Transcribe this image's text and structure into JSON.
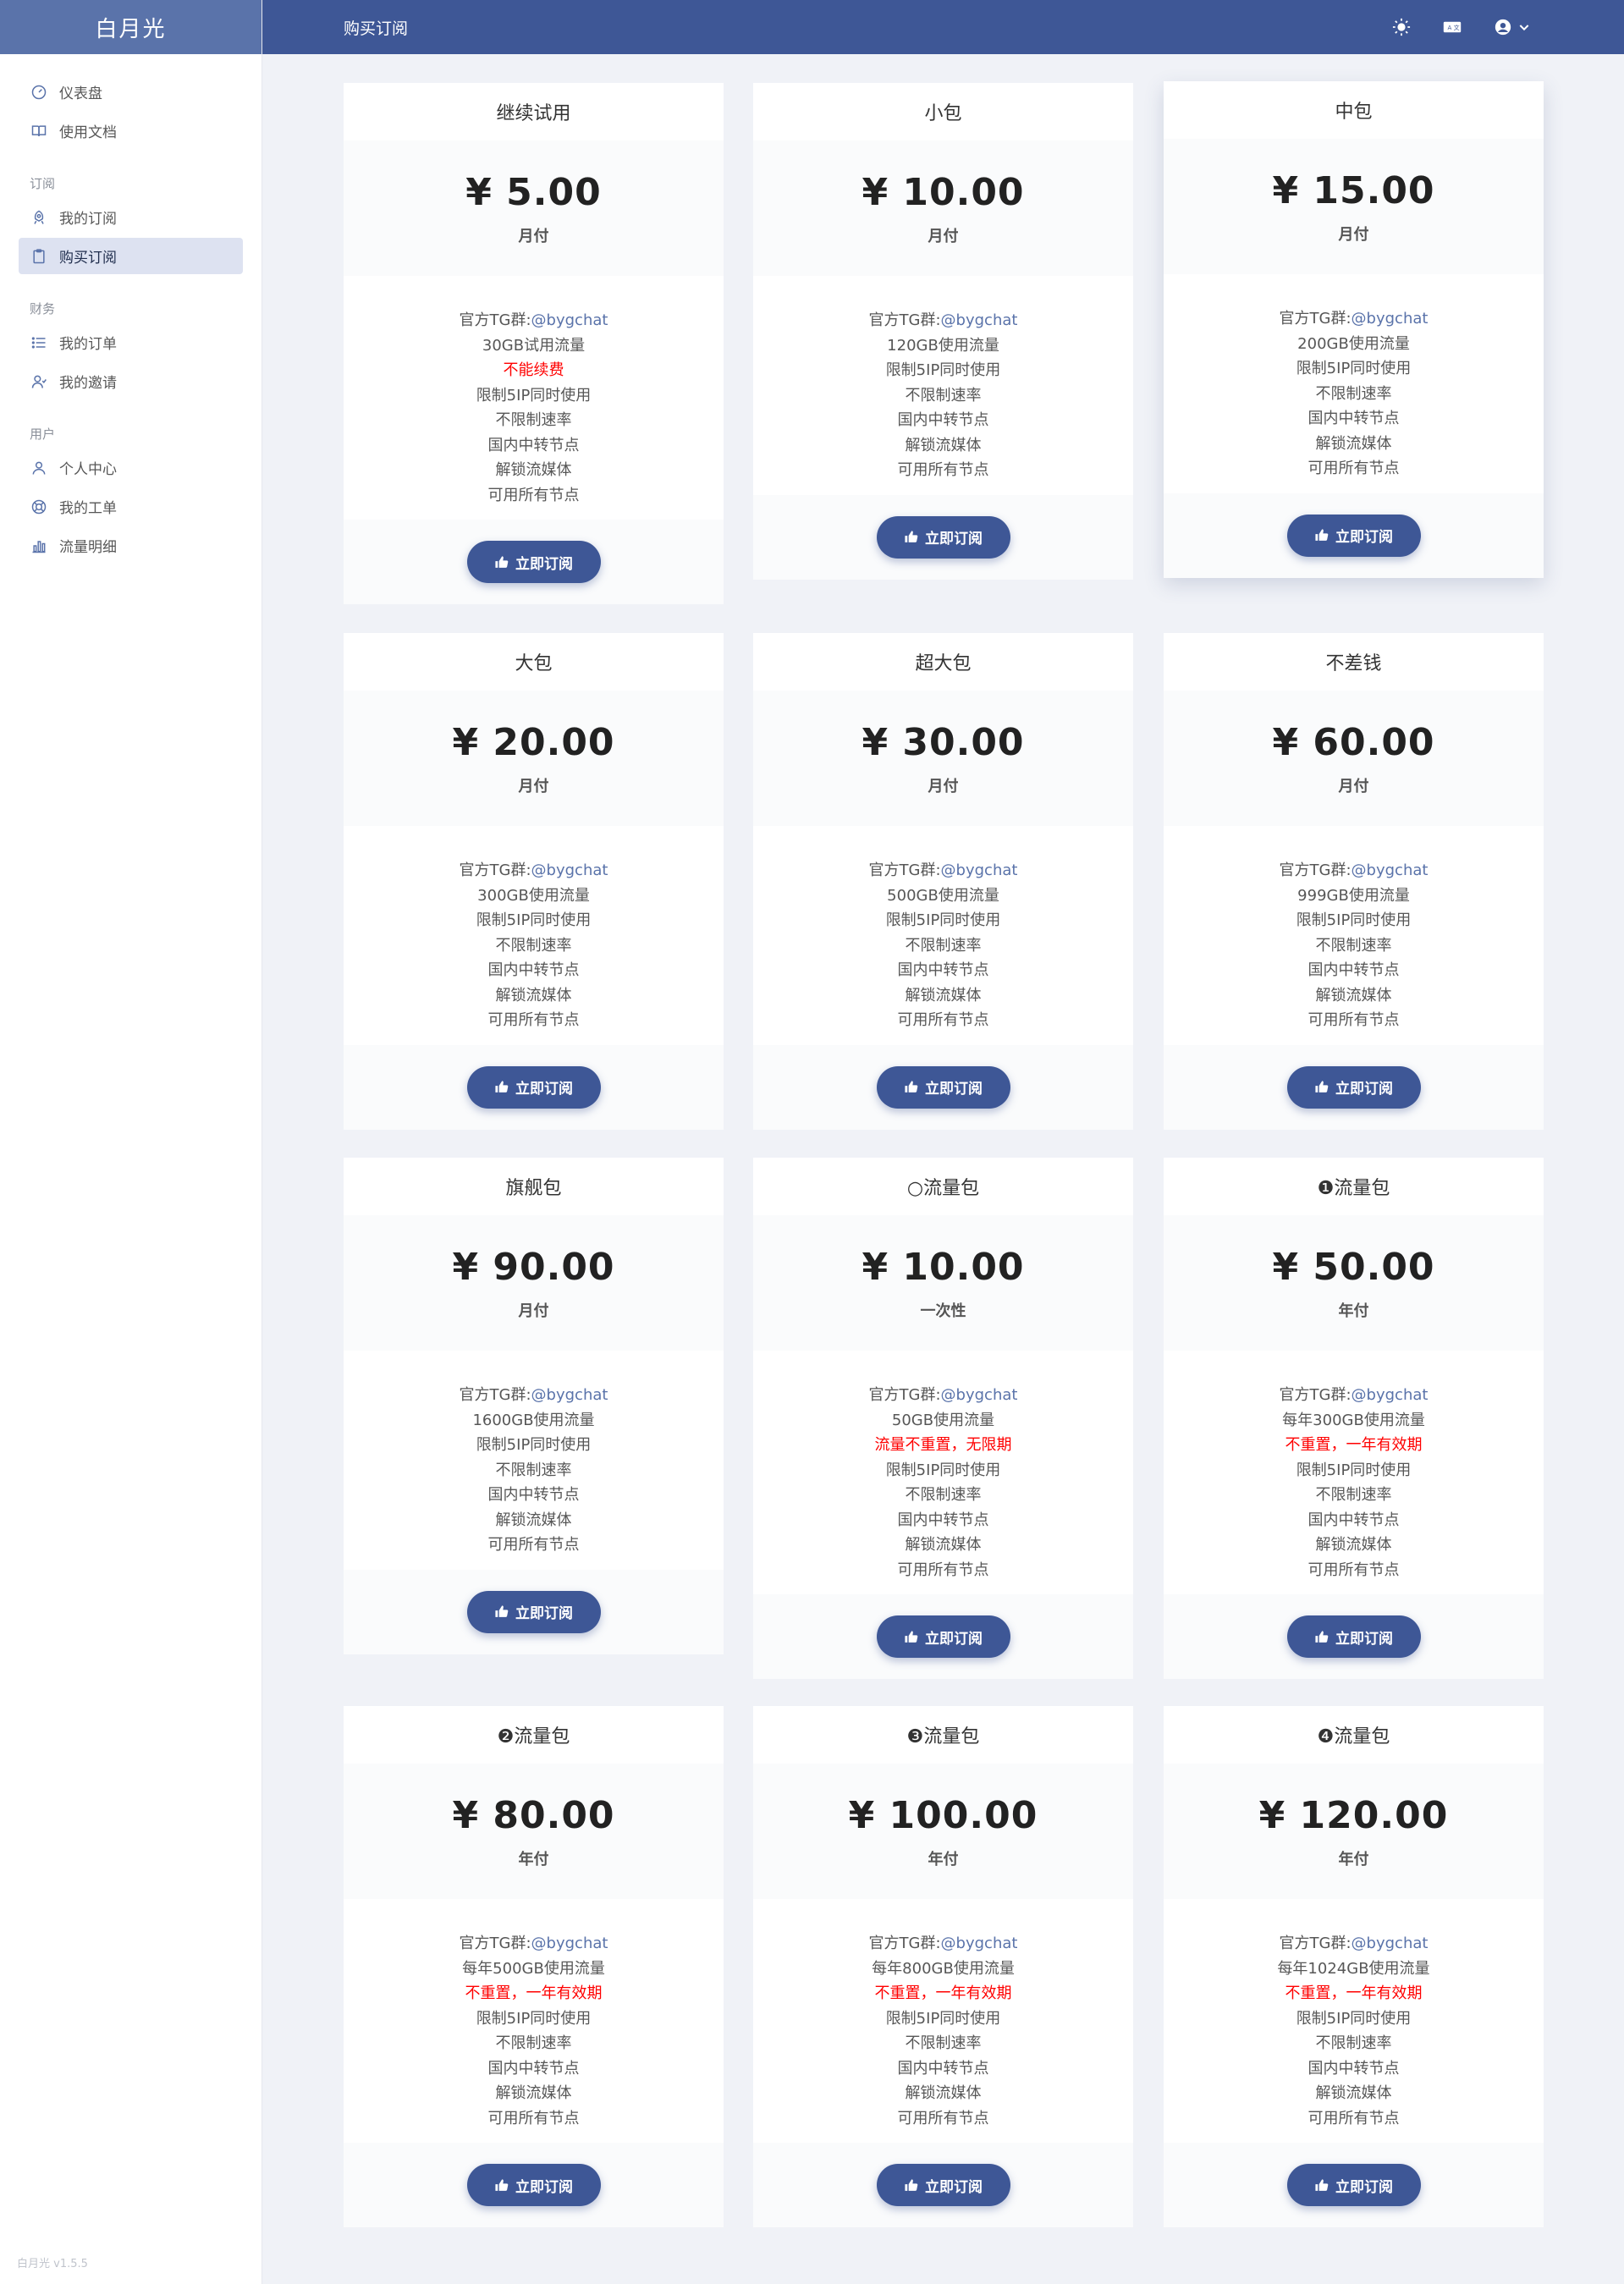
{
  "brand": "白月光",
  "version": "白月光 v1.5.5",
  "header": {
    "title": "购买订阅"
  },
  "sidebar": {
    "items_top": [
      {
        "label": "仪表盘",
        "icon": "dashboard-icon"
      },
      {
        "label": "使用文档",
        "icon": "book-icon"
      }
    ],
    "section_subscribe": "订阅",
    "items_subscribe": [
      {
        "label": "我的订阅",
        "icon": "rocket-icon"
      },
      {
        "label": "购买订阅",
        "icon": "clipboard-icon",
        "active": true
      }
    ],
    "section_finance": "财务",
    "items_finance": [
      {
        "label": "我的订单",
        "icon": "list-icon"
      },
      {
        "label": "我的邀请",
        "icon": "users-icon"
      }
    ],
    "section_user": "用户",
    "items_user": [
      {
        "label": "个人中心",
        "icon": "user-icon"
      },
      {
        "label": "我的工单",
        "icon": "support-icon"
      },
      {
        "label": "流量明细",
        "icon": "bar-chart-icon"
      }
    ]
  },
  "button_label": "立即订阅",
  "tg_prefix": "官方TG群:",
  "tg_handle": "@bygchat",
  "plans": [
    {
      "name": "继续试用",
      "price": "¥ 5.00",
      "period": "月付",
      "features": [
        {
          "t": "30GB试用流量"
        },
        {
          "t": "不能续费",
          "red": true
        },
        {
          "t": "限制5IP同时使用"
        },
        {
          "t": "不限制速率"
        },
        {
          "t": "国内中转节点"
        },
        {
          "t": "解锁流媒体"
        },
        {
          "t": "可用所有节点"
        }
      ]
    },
    {
      "name": "小包",
      "price": "¥ 10.00",
      "period": "月付",
      "features": [
        {
          "t": "120GB使用流量"
        },
        {
          "t": "限制5IP同时使用"
        },
        {
          "t": "不限制速率"
        },
        {
          "t": "国内中转节点"
        },
        {
          "t": "解锁流媒体"
        },
        {
          "t": "可用所有节点"
        }
      ]
    },
    {
      "name": "中包",
      "price": "¥ 15.00",
      "period": "月付",
      "features": [
        {
          "t": "200GB使用流量"
        },
        {
          "t": "限制5IP同时使用"
        },
        {
          "t": "不限制速率"
        },
        {
          "t": "国内中转节点"
        },
        {
          "t": "解锁流媒体"
        },
        {
          "t": "可用所有节点"
        }
      ]
    },
    {
      "name": "大包",
      "price": "¥ 20.00",
      "period": "月付",
      "features": [
        {
          "t": "300GB使用流量"
        },
        {
          "t": "限制5IP同时使用"
        },
        {
          "t": "不限制速率"
        },
        {
          "t": "国内中转节点"
        },
        {
          "t": "解锁流媒体"
        },
        {
          "t": "可用所有节点"
        }
      ]
    },
    {
      "name": "超大包",
      "price": "¥ 30.00",
      "period": "月付",
      "features": [
        {
          "t": "500GB使用流量"
        },
        {
          "t": "限制5IP同时使用"
        },
        {
          "t": "不限制速率"
        },
        {
          "t": "国内中转节点"
        },
        {
          "t": "解锁流媒体"
        },
        {
          "t": "可用所有节点"
        }
      ]
    },
    {
      "name": "不差钱",
      "price": "¥ 60.00",
      "period": "月付",
      "features": [
        {
          "t": "999GB使用流量"
        },
        {
          "t": "限制5IP同时使用"
        },
        {
          "t": "不限制速率"
        },
        {
          "t": "国内中转节点"
        },
        {
          "t": "解锁流媒体"
        },
        {
          "t": "可用所有节点"
        }
      ]
    },
    {
      "name": "旗舰包",
      "price": "¥ 90.00",
      "period": "月付",
      "features": [
        {
          "t": "1600GB使用流量"
        },
        {
          "t": "限制5IP同时使用"
        },
        {
          "t": "不限制速率"
        },
        {
          "t": "国内中转节点"
        },
        {
          "t": "解锁流媒体"
        },
        {
          "t": "可用所有节点"
        }
      ]
    },
    {
      "name": "○流量包",
      "price": "¥ 10.00",
      "period": "一次性",
      "features": [
        {
          "t": "50GB使用流量"
        },
        {
          "t": "流量不重置，无限期",
          "red": true
        },
        {
          "t": "限制5IP同时使用"
        },
        {
          "t": "不限制速率"
        },
        {
          "t": "国内中转节点"
        },
        {
          "t": "解锁流媒体"
        },
        {
          "t": "可用所有节点"
        }
      ]
    },
    {
      "name": "❶流量包",
      "price": "¥ 50.00",
      "period": "年付",
      "features": [
        {
          "t": "每年300GB使用流量"
        },
        {
          "t": "不重置，一年有效期",
          "red": true
        },
        {
          "t": "限制5IP同时使用"
        },
        {
          "t": "不限制速率"
        },
        {
          "t": "国内中转节点"
        },
        {
          "t": "解锁流媒体"
        },
        {
          "t": "可用所有节点"
        }
      ]
    },
    {
      "name": "❷流量包",
      "price": "¥ 80.00",
      "period": "年付",
      "features": [
        {
          "t": "每年500GB使用流量"
        },
        {
          "t": "不重置，一年有效期",
          "red": true
        },
        {
          "t": "限制5IP同时使用"
        },
        {
          "t": "不限制速率"
        },
        {
          "t": "国内中转节点"
        },
        {
          "t": "解锁流媒体"
        },
        {
          "t": "可用所有节点"
        }
      ]
    },
    {
      "name": "❸流量包",
      "price": "¥ 100.00",
      "period": "年付",
      "features": [
        {
          "t": "每年800GB使用流量"
        },
        {
          "t": "不重置，一年有效期",
          "red": true
        },
        {
          "t": "限制5IP同时使用"
        },
        {
          "t": "不限制速率"
        },
        {
          "t": "国内中转节点"
        },
        {
          "t": "解锁流媒体"
        },
        {
          "t": "可用所有节点"
        }
      ]
    },
    {
      "name": "❹流量包",
      "price": "¥ 120.00",
      "period": "年付",
      "features": [
        {
          "t": "每年1024GB使用流量"
        },
        {
          "t": "不重置，一年有效期",
          "red": true
        },
        {
          "t": "限制5IP同时使用"
        },
        {
          "t": "不限制速率"
        },
        {
          "t": "国内中转节点"
        },
        {
          "t": "解锁流媒体"
        },
        {
          "t": "可用所有节点"
        }
      ]
    }
  ]
}
